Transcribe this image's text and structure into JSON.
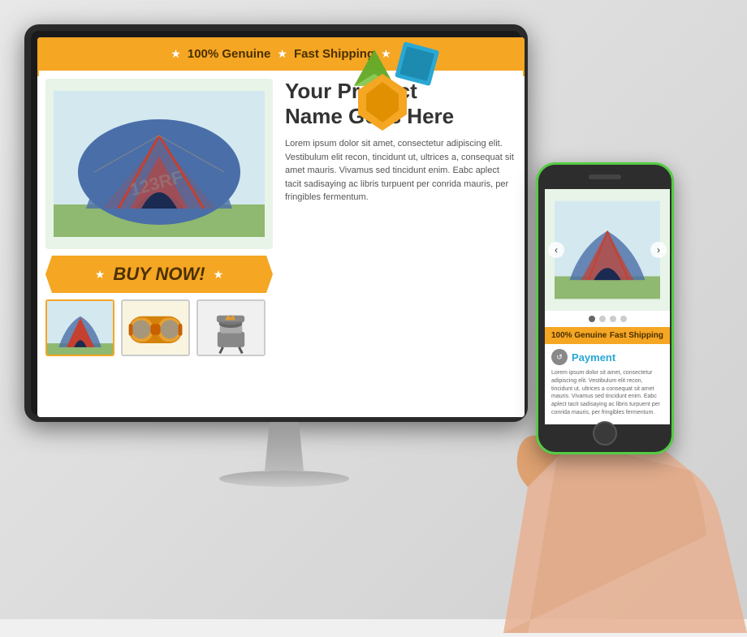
{
  "banner": {
    "badge1": "100% Genuine",
    "badge2": "Fast Shipping",
    "star_symbol": "★"
  },
  "product": {
    "title_line1": "Your Product",
    "title_line2": "Name Goes Here",
    "description": "Lorem ipsum dolor sit amet, consectetur adipiscing elit. Vestibulum elit recon, tincidunt ut, ultrices a, consequat sit amet mauris. Vivamus sed tincidunt enim. Eabc aplect tacit sadisaying ac libris turpuent per conrida mauris, per fringibles fermentum.",
    "buy_now_label": "BUY NOW!",
    "thumbnails": [
      {
        "id": 1,
        "label": "tent-thumbnail",
        "active": true
      },
      {
        "id": 2,
        "label": "goggles-thumbnail",
        "active": false
      },
      {
        "id": 3,
        "label": "stove-thumbnail",
        "active": false
      }
    ]
  },
  "phone": {
    "nav_left": "‹",
    "nav_right": "›",
    "dots_count": 4,
    "active_dot": 0,
    "banner_left": "100% Genuine",
    "banner_right": "Fast Shipping",
    "payment_title": "Payment",
    "payment_icon": "🔄",
    "payment_text": "Lorem ipsum dolor sit amet, consectetur adipiscing elit. Vestibulum elit recon, tincidunt ut, ultrices a consequat sit amet mauris. Vivamus sed tincidunt enim. Eabc aplect tacit sadisaying ac libris turpuent per conrida mauris, per fringibles fermentum."
  },
  "colors": {
    "orange": "#f5a623",
    "dark_text": "#4a3000",
    "screen_bg": "#fff",
    "phone_border": "#55cc44",
    "payment_blue": "#29a8d4"
  }
}
